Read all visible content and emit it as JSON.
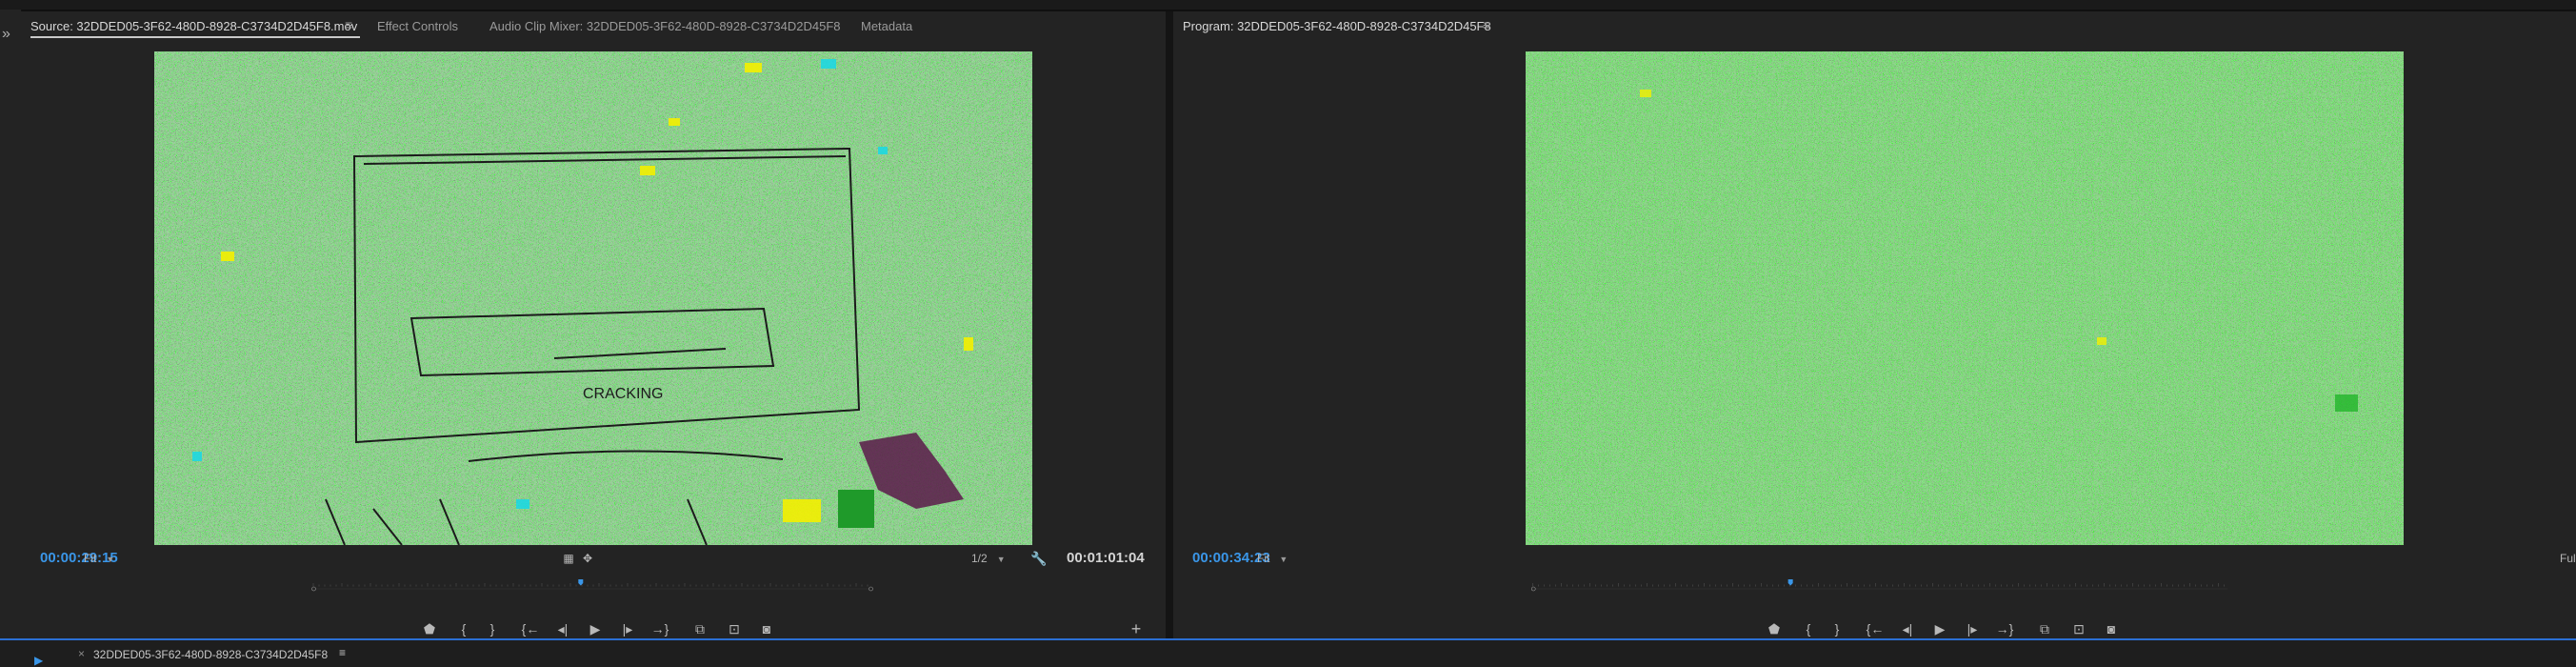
{
  "source_monitor": {
    "tabs": [
      {
        "label": "Source: 32DDED05-3F62-480D-8928-C3734D2D45F8.mov",
        "active": true
      },
      {
        "label": "Effect Controls",
        "active": false
      },
      {
        "label": "Audio Clip Mixer: 32DDED05-3F62-480D-8928-C3734D2D45F8",
        "active": false
      },
      {
        "label": "Metadata",
        "active": false
      }
    ],
    "timecode_current": "00:00:29:15",
    "zoom_label": "Fit",
    "resolution_label": "1/2",
    "timecode_duration": "00:01:01:04",
    "playhead_fraction": 0.48
  },
  "program_monitor": {
    "tab_label": "Program: 32DDED05-3F62-480D-8928-C3734D2D45F8",
    "timecode_current": "00:00:34:23",
    "zoom_label": "Fit",
    "cut_off_label": "Ful",
    "playhead_fraction": 0.52
  },
  "sequence_tab": {
    "label": "32DDED05-3F62-480D-8928-C3734D2D45F8"
  },
  "colors": {
    "accent_blue": "#3a96e8",
    "panel_bg": "#232323",
    "video_green": "#38ef2f"
  },
  "icons": {
    "left_expand": "»",
    "panel_menu": "≡"
  }
}
